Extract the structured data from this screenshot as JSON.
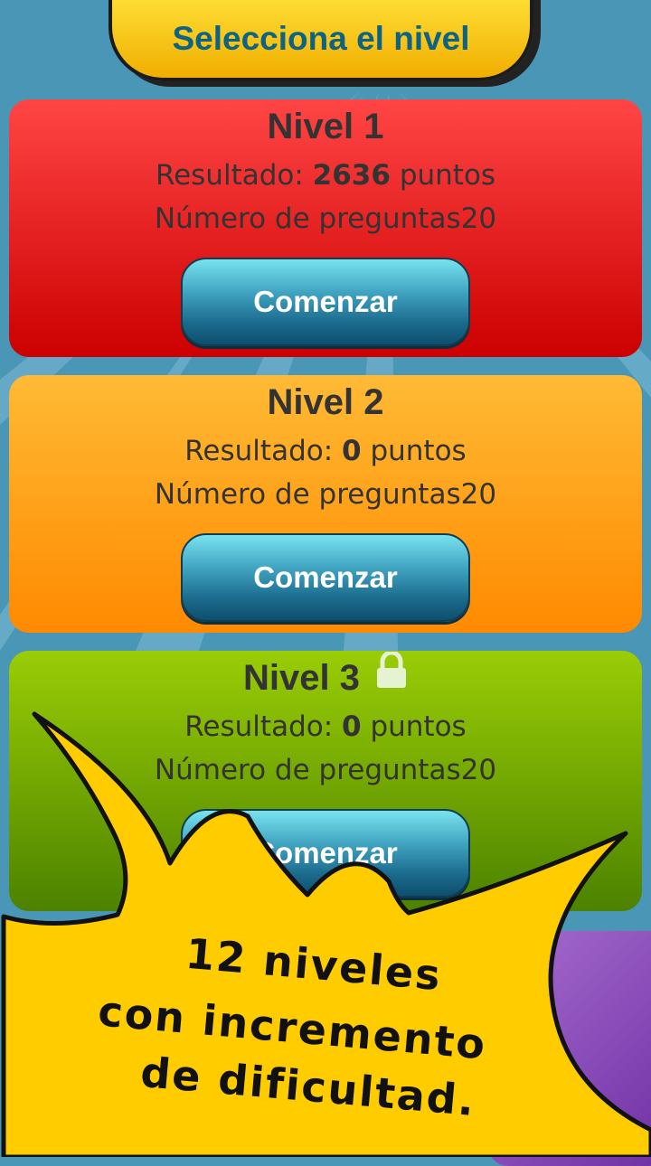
{
  "header": {
    "title": "Selecciona el nivel"
  },
  "levels": [
    {
      "title": "Nivel 1",
      "result_label": "Resultado:",
      "score": "2636",
      "points_label": "puntos",
      "questions_label": "Número de preguntas20",
      "button": "Comenzar",
      "locked": false
    },
    {
      "title": "Nivel 2",
      "result_label": "Resultado:",
      "score": "0",
      "points_label": "puntos",
      "questions_label": "Número de preguntas20",
      "button": "Comenzar",
      "locked": false
    },
    {
      "title": "Nivel 3",
      "result_label": "Resultado:",
      "score": "0",
      "points_label": "puntos",
      "questions_label": "Número de preguntas20",
      "button": "Comenzar",
      "locked": true
    }
  ],
  "promo": {
    "line1": "12 niveles",
    "line2": "con incremento",
    "line3": "de dificultad."
  },
  "colors": {
    "level1": "#e41c1c",
    "level2": "#ffa21a",
    "level3": "#7aae02",
    "level4": "#8a45bb",
    "button": "#2a89a8",
    "banner": "#f6c50c",
    "burst": "#ffcc00"
  },
  "icons": {
    "lock": "lock-icon"
  }
}
